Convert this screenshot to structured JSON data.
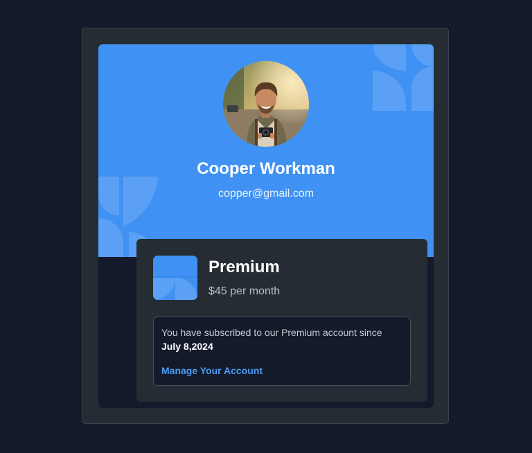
{
  "profile": {
    "name": "Cooper Workman",
    "email": "copper@gmail.com",
    "avatar_icon": "person-photo"
  },
  "plan": {
    "name": "Premium",
    "price": "$45 per month",
    "icon": "premium-plan-icon"
  },
  "subscription": {
    "message": "You have subscribed to our Premium account since",
    "since_date": "July 8,2024",
    "manage_link": "Manage Your Account"
  },
  "colors": {
    "background": "#131a2a",
    "card": "#252c33",
    "accent": "#3f92f3",
    "link": "#4c9cf5"
  }
}
